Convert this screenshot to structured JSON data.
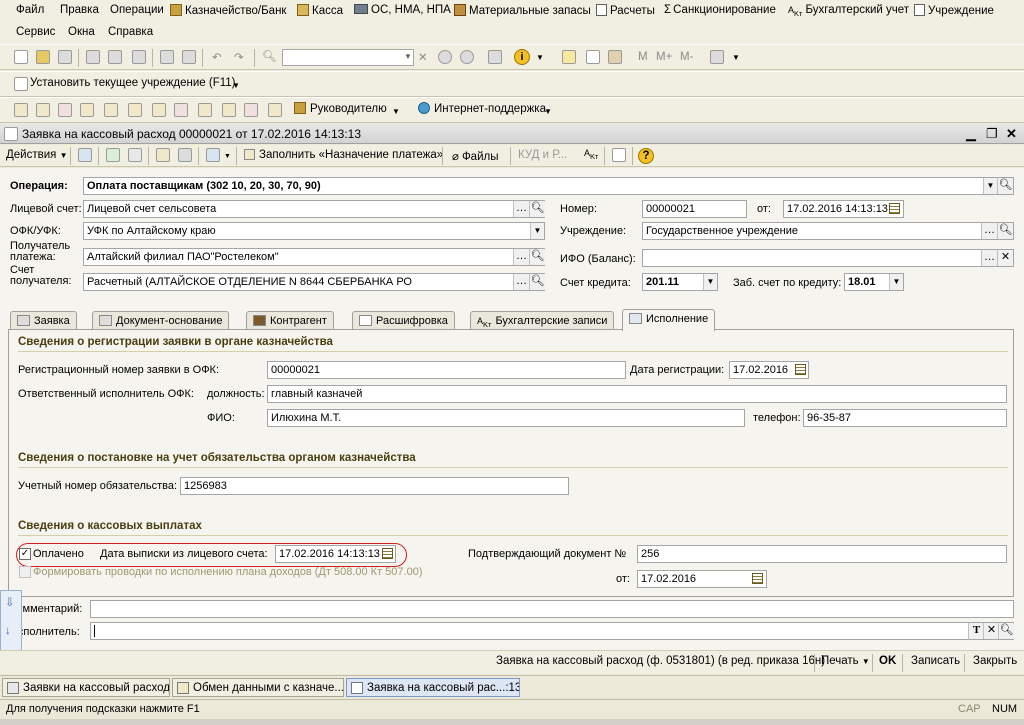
{
  "menu": [
    "Файл",
    "Правка",
    "Операции",
    "Казначейство/Банк",
    "Касса",
    "ОС, НМА, НПА",
    "Материальные запасы",
    "Расчеты",
    "Санкционирование",
    "Бухгалтерский учет",
    "Учреждение",
    "Сервис",
    "Окна",
    "Справка"
  ],
  "toolbar": {
    "search_placeholder": "",
    "m_buttons": [
      "M",
      "M+",
      "M-"
    ],
    "set_institution": "Установить текущее учреждение (F11)",
    "manager": "Руководителю",
    "internet_support": "Интернет-поддержка"
  },
  "window": {
    "title": "Заявка на кассовый расход 00000021 от 17.02.2016 14:13:13"
  },
  "actions": {
    "actions": "Действия",
    "fill": "Заполнить «Назначение платежа»",
    "files": "Файлы",
    "kud": "КУД и Р..."
  },
  "form": {
    "operation_label": "Операция:",
    "operation_value": "Оплата поставщикам (302 10, 20, 30, 70, 90)",
    "account_label": "Лицевой счет:",
    "account_value": "Лицевой счет сельсовета",
    "number_label": "Номер:",
    "number_value": "00000021",
    "from_label": "от:",
    "from_value": "17.02.2016 14:13:13",
    "ofk_label": "ОФК/УФК:",
    "ofk_value": "УФК по Алтайскому краю",
    "institution_label": "Учреждение:",
    "institution_value": "Государственное учреждение",
    "payee_label1": "Получатель",
    "payee_label2": "платежа:",
    "payee_value": "Алтайский филиал ПАО\"Ростелеком\"",
    "ifo_label": "ИФО (Баланс):",
    "ifo_value": "",
    "payee_account_label1": "Счет",
    "payee_account_label2": "получателя:",
    "payee_account_value": "Расчетный (АЛТАЙСКОЕ ОТДЕЛЕНИЕ N 8644 СБЕРБАНКА РО",
    "credit_account_label": "Счет кредита:",
    "credit_account_value": "201.11",
    "credit_zab_label": "Заб. счет по кредиту:",
    "credit_zab_value": "18.01"
  },
  "tabs": [
    "Заявка",
    "Документ-основание",
    "Контрагент",
    "Расшифровка",
    "Бухгалтерские записи",
    "Исполнение"
  ],
  "execution": {
    "sect1": "Сведения о регистрации заявки в органе казначейства",
    "regnum_label": "Регистрационный номер заявки в ОФК:",
    "regnum_value": "00000021",
    "regdate_label": "Дата регистрации:",
    "regdate_value": "17.02.2016",
    "responsible_label": "Ответственный исполнитель ОФК:",
    "position_label": "должность:",
    "position_value": "главный казначей",
    "fio_label": "ФИО:",
    "fio_value": "Илюхина М.Т.",
    "phone_label": "телефон:",
    "phone_value": "96-35-87",
    "sect2": "Сведения о постановке на учет обязательства органом казначейства",
    "obligation_label": "Учетный номер обязательства:",
    "obligation_value": "1256983",
    "sect3": "Сведения о кассовых выплатах",
    "paid_label": "Оплачено",
    "extract_date_label": "Дата выписки из лицевого счета:",
    "extract_date_value": "17.02.2016 14:13:13",
    "confirm_doc_label": "Подтверждающий документ №",
    "confirm_doc_value": "256",
    "confirm_from_label": "от:",
    "confirm_from_value": "17.02.2016",
    "postings_label": "Формировать проводки по исполнению плана доходов (Дт 508.00 Кт 507.00)"
  },
  "comment_label": "Комментарий:",
  "executor_label": "Исполнитель:",
  "bottom": {
    "print_form": "Заявка на кассовый расход (ф. 0531801) (в ред. приказа 16н)",
    "print": "Печать",
    "ok": "OK",
    "save": "Записать",
    "close": "Закрыть"
  },
  "taskbar": [
    "Заявки на кассовый расход",
    "Обмен данными с казначе...",
    "Заявка на кассовый рас...:13"
  ],
  "status": {
    "hint": "Для получения подсказки нажмите F1",
    "cap": "CAP",
    "num": "NUM"
  }
}
